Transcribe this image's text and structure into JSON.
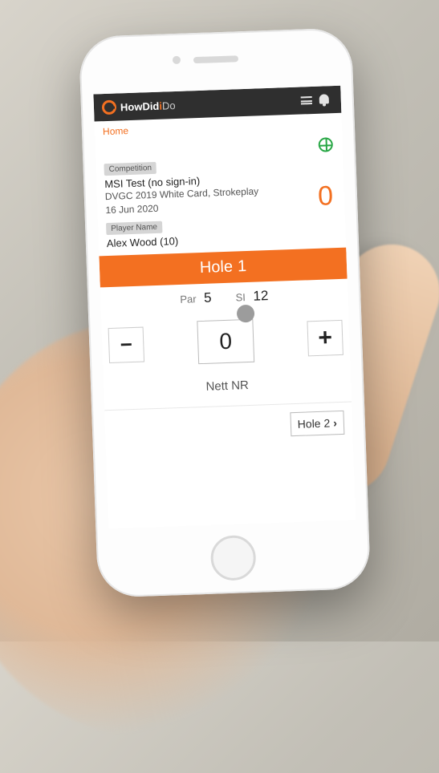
{
  "header": {
    "brand_a": "HowDid",
    "brand_b": "i",
    "brand_c": "Do"
  },
  "breadcrumb": {
    "home": "Home"
  },
  "competition": {
    "badge": "Competition",
    "title": "MSI Test (no sign-in)",
    "course": "DVGC 2019 White Card, Strokeplay",
    "date": "16 Jun 2020",
    "total": "0"
  },
  "player": {
    "badge": "Player Name",
    "name": "Alex Wood (10)"
  },
  "hole": {
    "label": "Hole",
    "number": "1",
    "par_label": "Par",
    "par_value": "5",
    "si_label": "SI",
    "si_value": "12"
  },
  "score": {
    "value": "0",
    "nett": "Nett NR"
  },
  "nav": {
    "next": "Hole 2"
  }
}
